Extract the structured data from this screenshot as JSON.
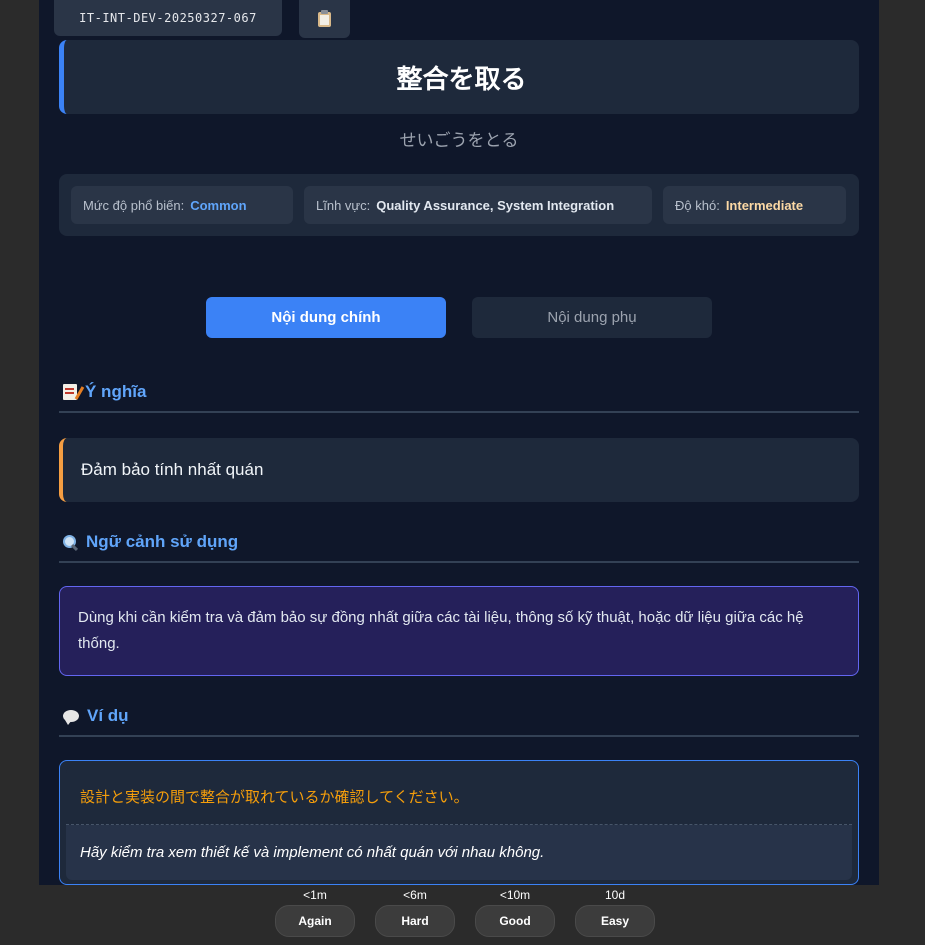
{
  "card": {
    "id": "IT-INT-DEV-20250327-067",
    "copy_icon": "clipboard-icon",
    "term": "整合を取る",
    "reading": "せいごうをとる"
  },
  "meta": {
    "popularity": {
      "label": "Mức độ phổ biến:",
      "value": "Common",
      "color": "#60a5fa"
    },
    "field": {
      "label": "Lĩnh vực:",
      "value": "Quality Assurance, System Integration",
      "color": "#e2e8f0"
    },
    "difficulty": {
      "label": "Độ khó:",
      "value": "Intermediate",
      "color": "#fcd9a5"
    }
  },
  "tabs": {
    "main": "Nội dung chính",
    "sub": "Nội dung phụ"
  },
  "sections": {
    "meaning": {
      "icon": "memo-icon",
      "title": "Ý nghĩa",
      "text": "Đảm bảo tính nhất quán"
    },
    "context": {
      "icon": "magnifying-glass-icon",
      "title": "Ngữ cảnh sử dụng",
      "text": "Dùng khi cần kiểm tra và đảm bảo sự đồng nhất giữa các tài liệu, thông số kỹ thuật, hoặc dữ liệu giữa các hệ thống."
    },
    "example": {
      "icon": "speech-bubble-icon",
      "title": "Ví dụ",
      "jp": "設計と実装の間で整合が取れているか確認してください。",
      "vi": "Hãy kiểm tra xem thiết kế và implement có nhất quán với nhau không."
    }
  },
  "review": {
    "again": {
      "interval": "<1m",
      "label": "Again"
    },
    "hard": {
      "interval": "<6m",
      "label": "Hard"
    },
    "good": {
      "interval": "<10m",
      "label": "Good"
    },
    "easy": {
      "interval": "10d",
      "label": "Easy"
    }
  },
  "colors": {
    "accent": "#3b82f6",
    "heading": "#60a5fa",
    "meaning_border": "#f59e42",
    "context_bg": "#25205a",
    "example_jp": "#f59e0b"
  }
}
